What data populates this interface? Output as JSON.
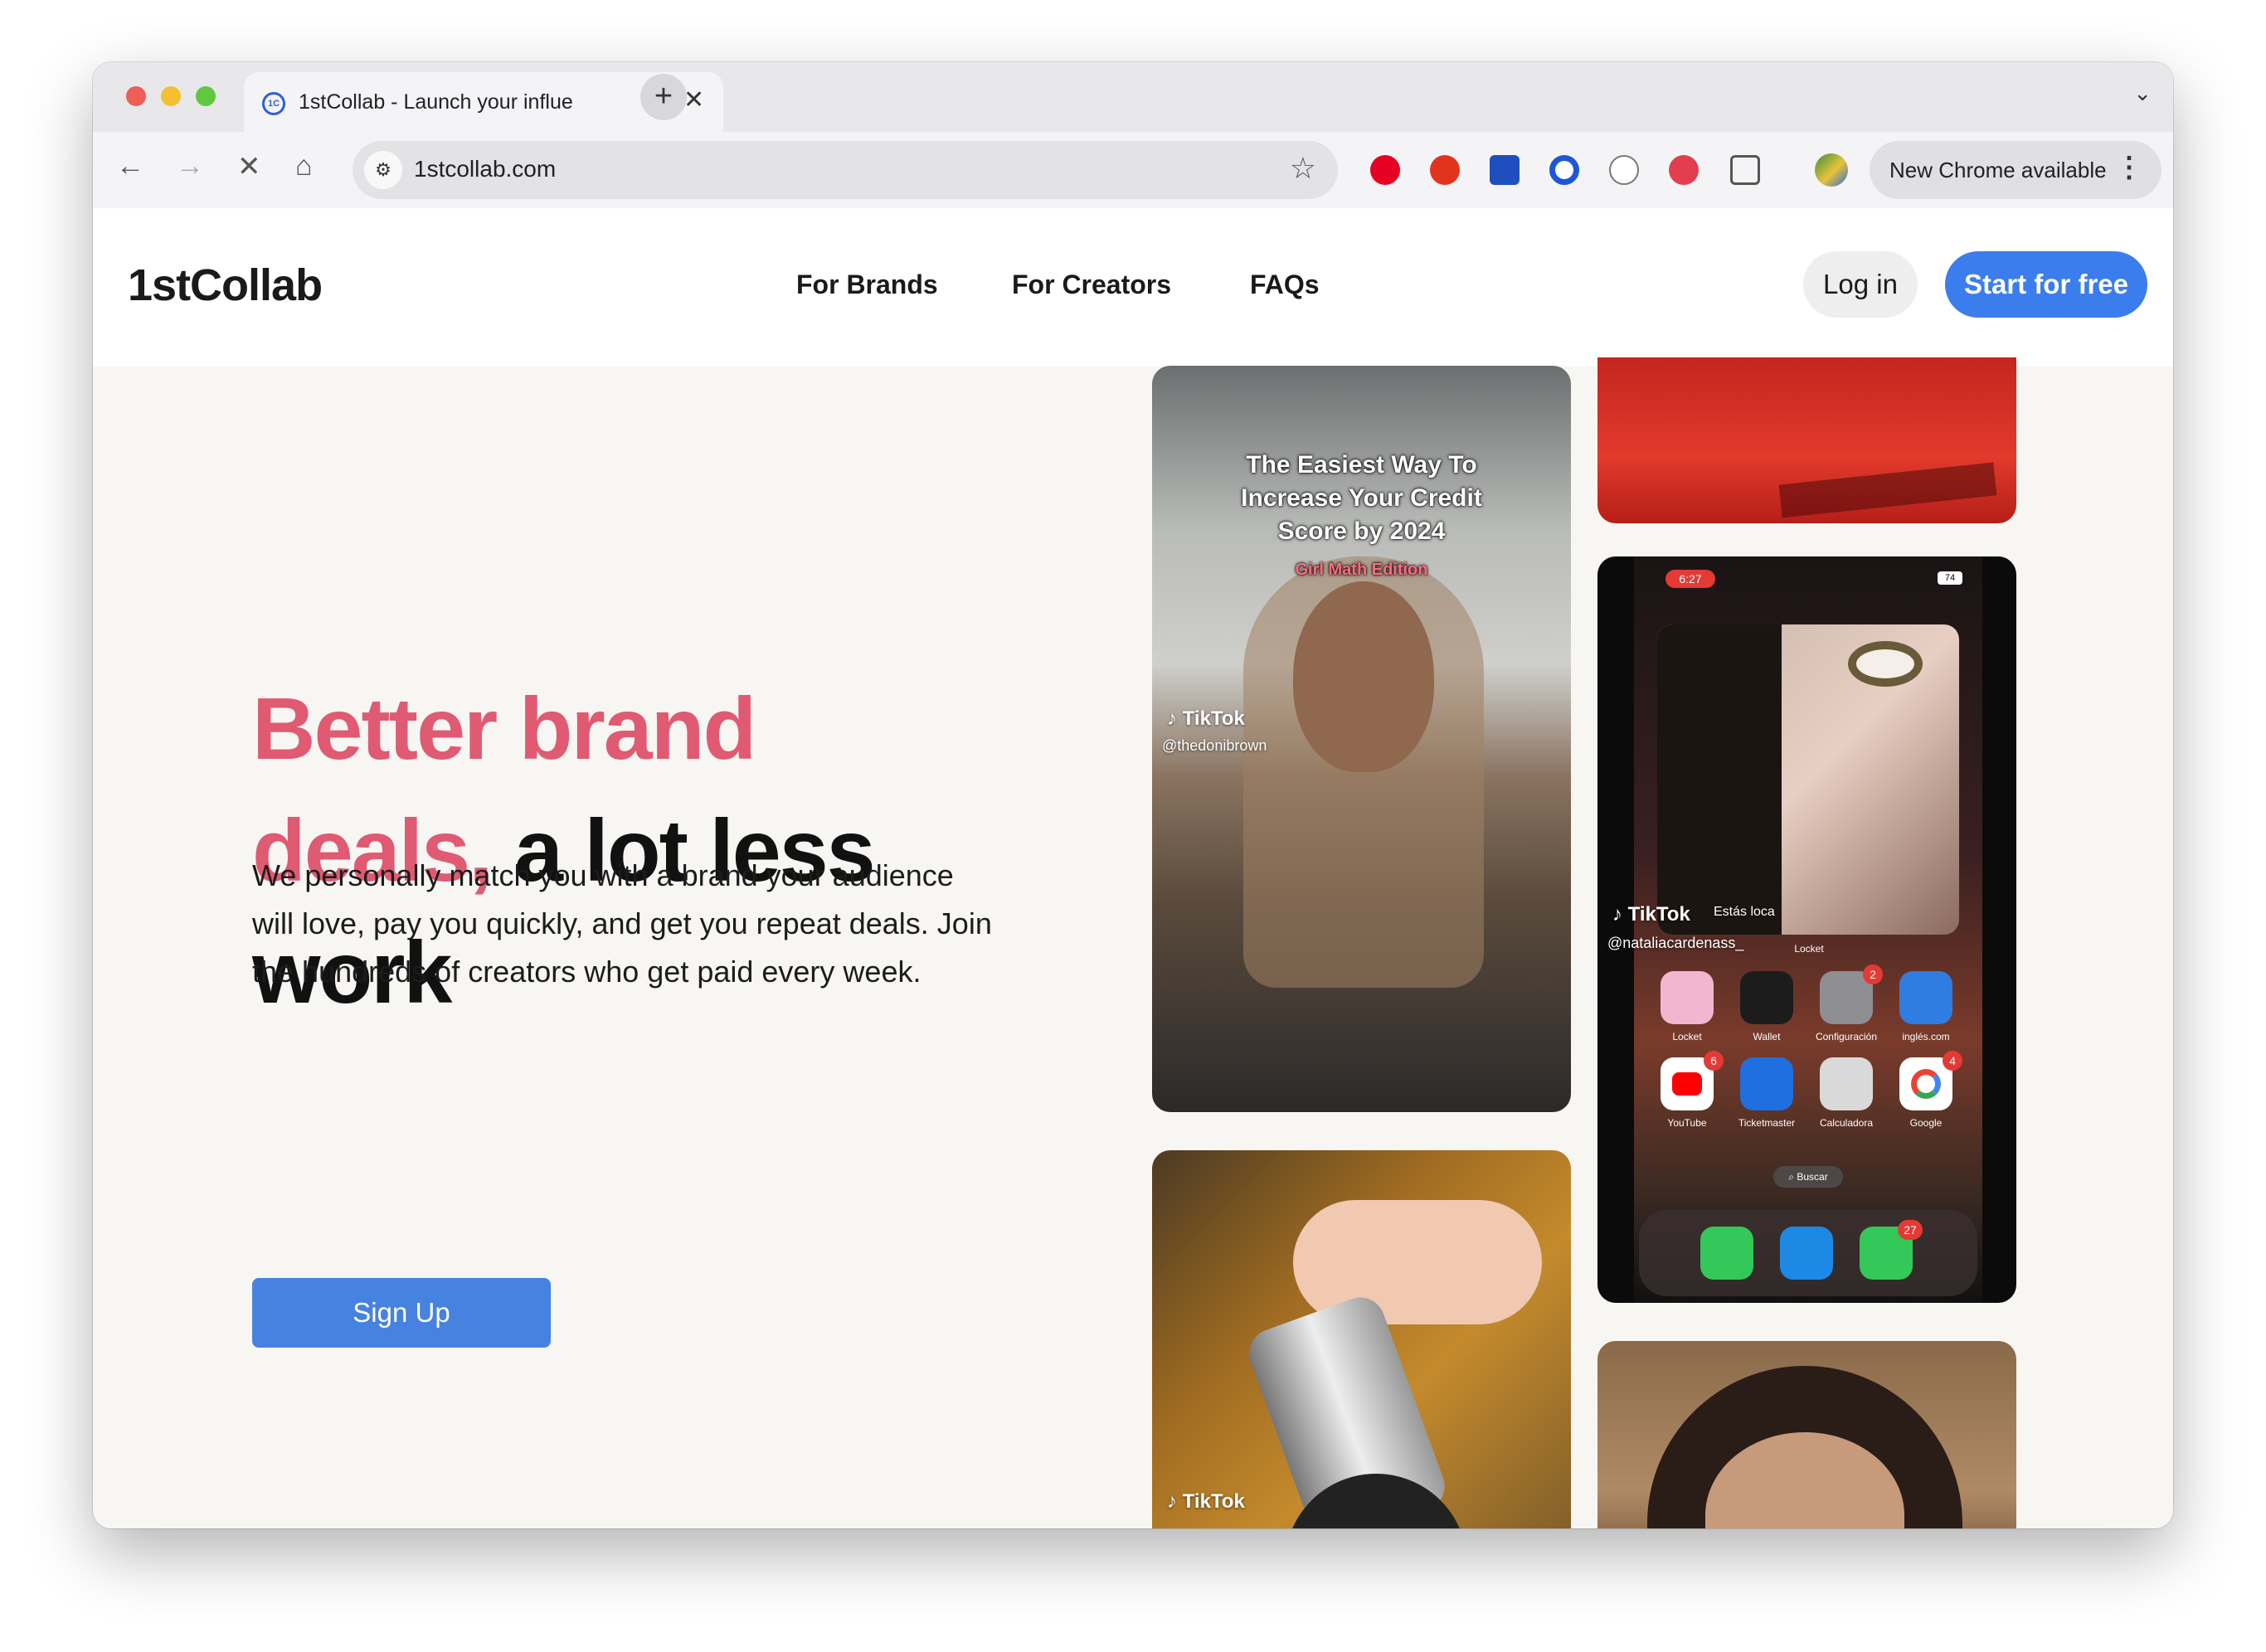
{
  "browser": {
    "tab_title": "1stCollab - Launch your influe",
    "tab_favicon": "1C",
    "url": "1stcollab.com",
    "update_label": "New Chrome available"
  },
  "site": {
    "logo": "1stCollab",
    "nav": [
      "For Brands",
      "For Creators",
      "FAQs"
    ],
    "login_label": "Log in",
    "start_label": "Start for free"
  },
  "hero": {
    "line1": "Better brand",
    "line2_pink": "deals,",
    "line2_dark": "a lot less",
    "line3": "work",
    "description": "We personally match you with a brand your audience will love, pay you quickly, and get you repeat deals. Join the hundreds of creators who get paid every week.",
    "signup_label": "Sign Up",
    "accent_color": "#e05a72",
    "button_color": "#4682df"
  },
  "videos": {
    "tiktok_label": "TikTok",
    "card1": {
      "caption": "The Easiest Way To Increase Your Credit Score by 2024",
      "subcaption": "Girl Math Edition",
      "handle": "@thedonibrown"
    },
    "card4": {
      "time": "6:27",
      "battery": "74",
      "handle": "@nataliacardenass_",
      "song": "Estás loca",
      "widget_label": "Locket",
      "search_label": "Buscar",
      "apps": [
        {
          "label": "Locket",
          "badge": ""
        },
        {
          "label": "Wallet",
          "badge": ""
        },
        {
          "label": "Configuración",
          "badge": "2"
        },
        {
          "label": "inglés.com",
          "badge": ""
        },
        {
          "label": "YouTube",
          "badge": "6"
        },
        {
          "label": "Ticketmaster",
          "badge": ""
        },
        {
          "label": "Calculadora",
          "badge": ""
        },
        {
          "label": "Google",
          "badge": "4"
        }
      ],
      "messages_badge": "27"
    }
  }
}
